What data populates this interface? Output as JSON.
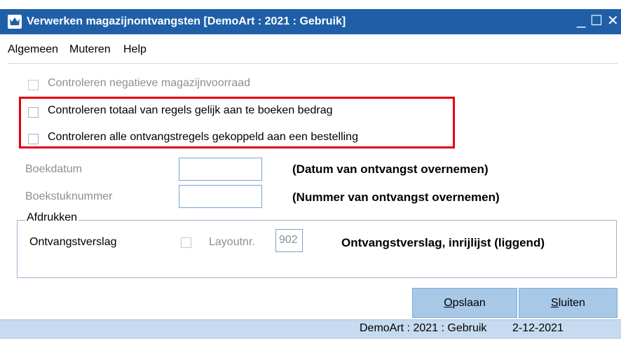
{
  "window": {
    "title": "Verwerken magazijnontvangsten  [DemoArt : 2021 : Gebruik]",
    "minimize_symbol": "_",
    "maximize_symbol": "☐",
    "close_symbol": "✕"
  },
  "menu": {
    "items": [
      "Algemeen",
      "Muteren",
      "Help"
    ]
  },
  "options": {
    "negatieve_voorraad": "Controleren negatieve magazijnvoorraad",
    "totaal_regels": "Controleren totaal van regels gelijk aan te boeken bedrag",
    "ontvangstregels": "Controleren alle ontvangstregels gekoppeld aan een bestelling"
  },
  "fields": {
    "boekdatum": {
      "label": "Boekdatum",
      "value": "",
      "note": "(Datum van ontvangst overnemen)"
    },
    "boekstuknummer": {
      "label": "Boekstuknummer",
      "value": "",
      "note": "(Nummer van ontvangst overnemen)"
    }
  },
  "afdrukken": {
    "legend": "Afdrukken",
    "report_label": "Ontvangstverslag",
    "layout_label": "Layoutnr.",
    "layout_value": "902",
    "report_description": "Ontvangstverslag, inrijlijst (liggend)"
  },
  "buttons": {
    "save_mnemonic": "O",
    "save_rest": "pslaan",
    "close_mnemonic": "S",
    "close_rest": "luiten"
  },
  "status": {
    "context": "DemoArt : 2021 : Gebruik",
    "date": "2-12-2021"
  },
  "colors": {
    "titlebar": "#1f5fa8",
    "highlight": "#e3000f",
    "button": "#a8c8e8",
    "statusbar": "#c6dbef"
  },
  "icons": {
    "app": "crown-icon",
    "checkbox": "checkbox-icon"
  }
}
